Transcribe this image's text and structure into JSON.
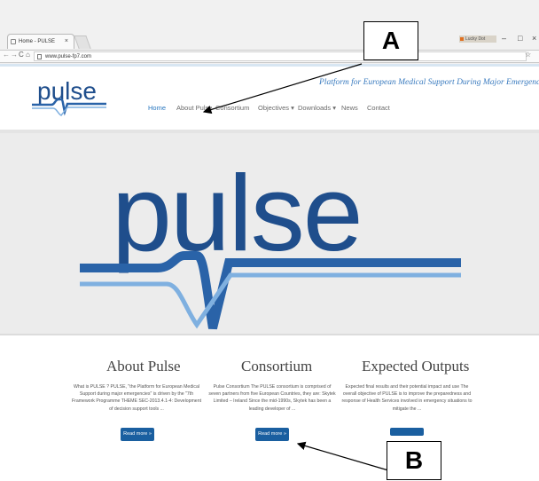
{
  "browser": {
    "tab_title": "Home - PULSE",
    "tab_close": "×",
    "url": "www.pulse-fp7.com",
    "extension_label": "Lucky Dot",
    "window_controls": [
      "–",
      "□",
      "×"
    ],
    "nav_buttons": [
      "←",
      "→",
      "C",
      "⌂"
    ],
    "star": "☆"
  },
  "site": {
    "logo_text": "pulse",
    "tagline": "Platform for European Medical Support During Major Emergencies",
    "nav": [
      {
        "label": "Home",
        "active": true
      },
      {
        "label": "About Pulse"
      },
      {
        "label": "Consortium"
      },
      {
        "label": "Objectives ▾"
      },
      {
        "label": "Downloads ▾"
      },
      {
        "label": "News"
      },
      {
        "label": "Contact"
      }
    ],
    "hero_logo_text": "pulse"
  },
  "columns": [
    {
      "title": "About Pulse",
      "text": "What is PULSE ? PULSE, \"the Platform for European Medical Support during major emergencies\" is driven by the \"7th Framework Programme THEME SEC-2013.4.1-4: Development of decision support tools ...",
      "button": "Read more »"
    },
    {
      "title": "Consortium",
      "text": "Pulse Consortium The PULSE consortium is comprised of seven partners from five European Countries, they are: Skytek Limited – Ireland Since the mid-1990s, Skytek has been a leading developer of ...",
      "button": "Read more »"
    },
    {
      "title": "Expected Outputs",
      "text": "Expected final results and their potential impact and use The overall objective of PULSE is to improve the preparedness and response of Health Services involved in emergency situations to mitigate the ...",
      "button": ""
    }
  ],
  "annotations": {
    "a": "A",
    "b": "B"
  },
  "colors": {
    "brand_blue": "#1a5fa0",
    "link_blue": "#2a78c0",
    "tagline_blue": "#3a7bbf"
  }
}
